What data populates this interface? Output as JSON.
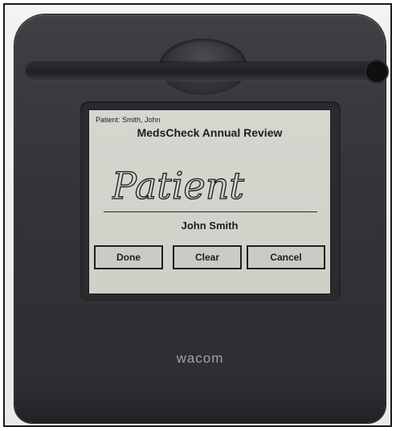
{
  "device": {
    "brand": "wacom"
  },
  "screen": {
    "patient_label": "Patient: Smith, John",
    "document_title": "MedsCheck Annual Review",
    "signature_text": "Patient",
    "signer_name": "John Smith"
  },
  "buttons": {
    "done": "Done",
    "clear": "Clear",
    "cancel": "Cancel"
  },
  "colors": {
    "device_body": "#333438",
    "screen_background": "#d3d3cc",
    "text": "#1d1d1d",
    "logo": "#a2a3a8"
  }
}
